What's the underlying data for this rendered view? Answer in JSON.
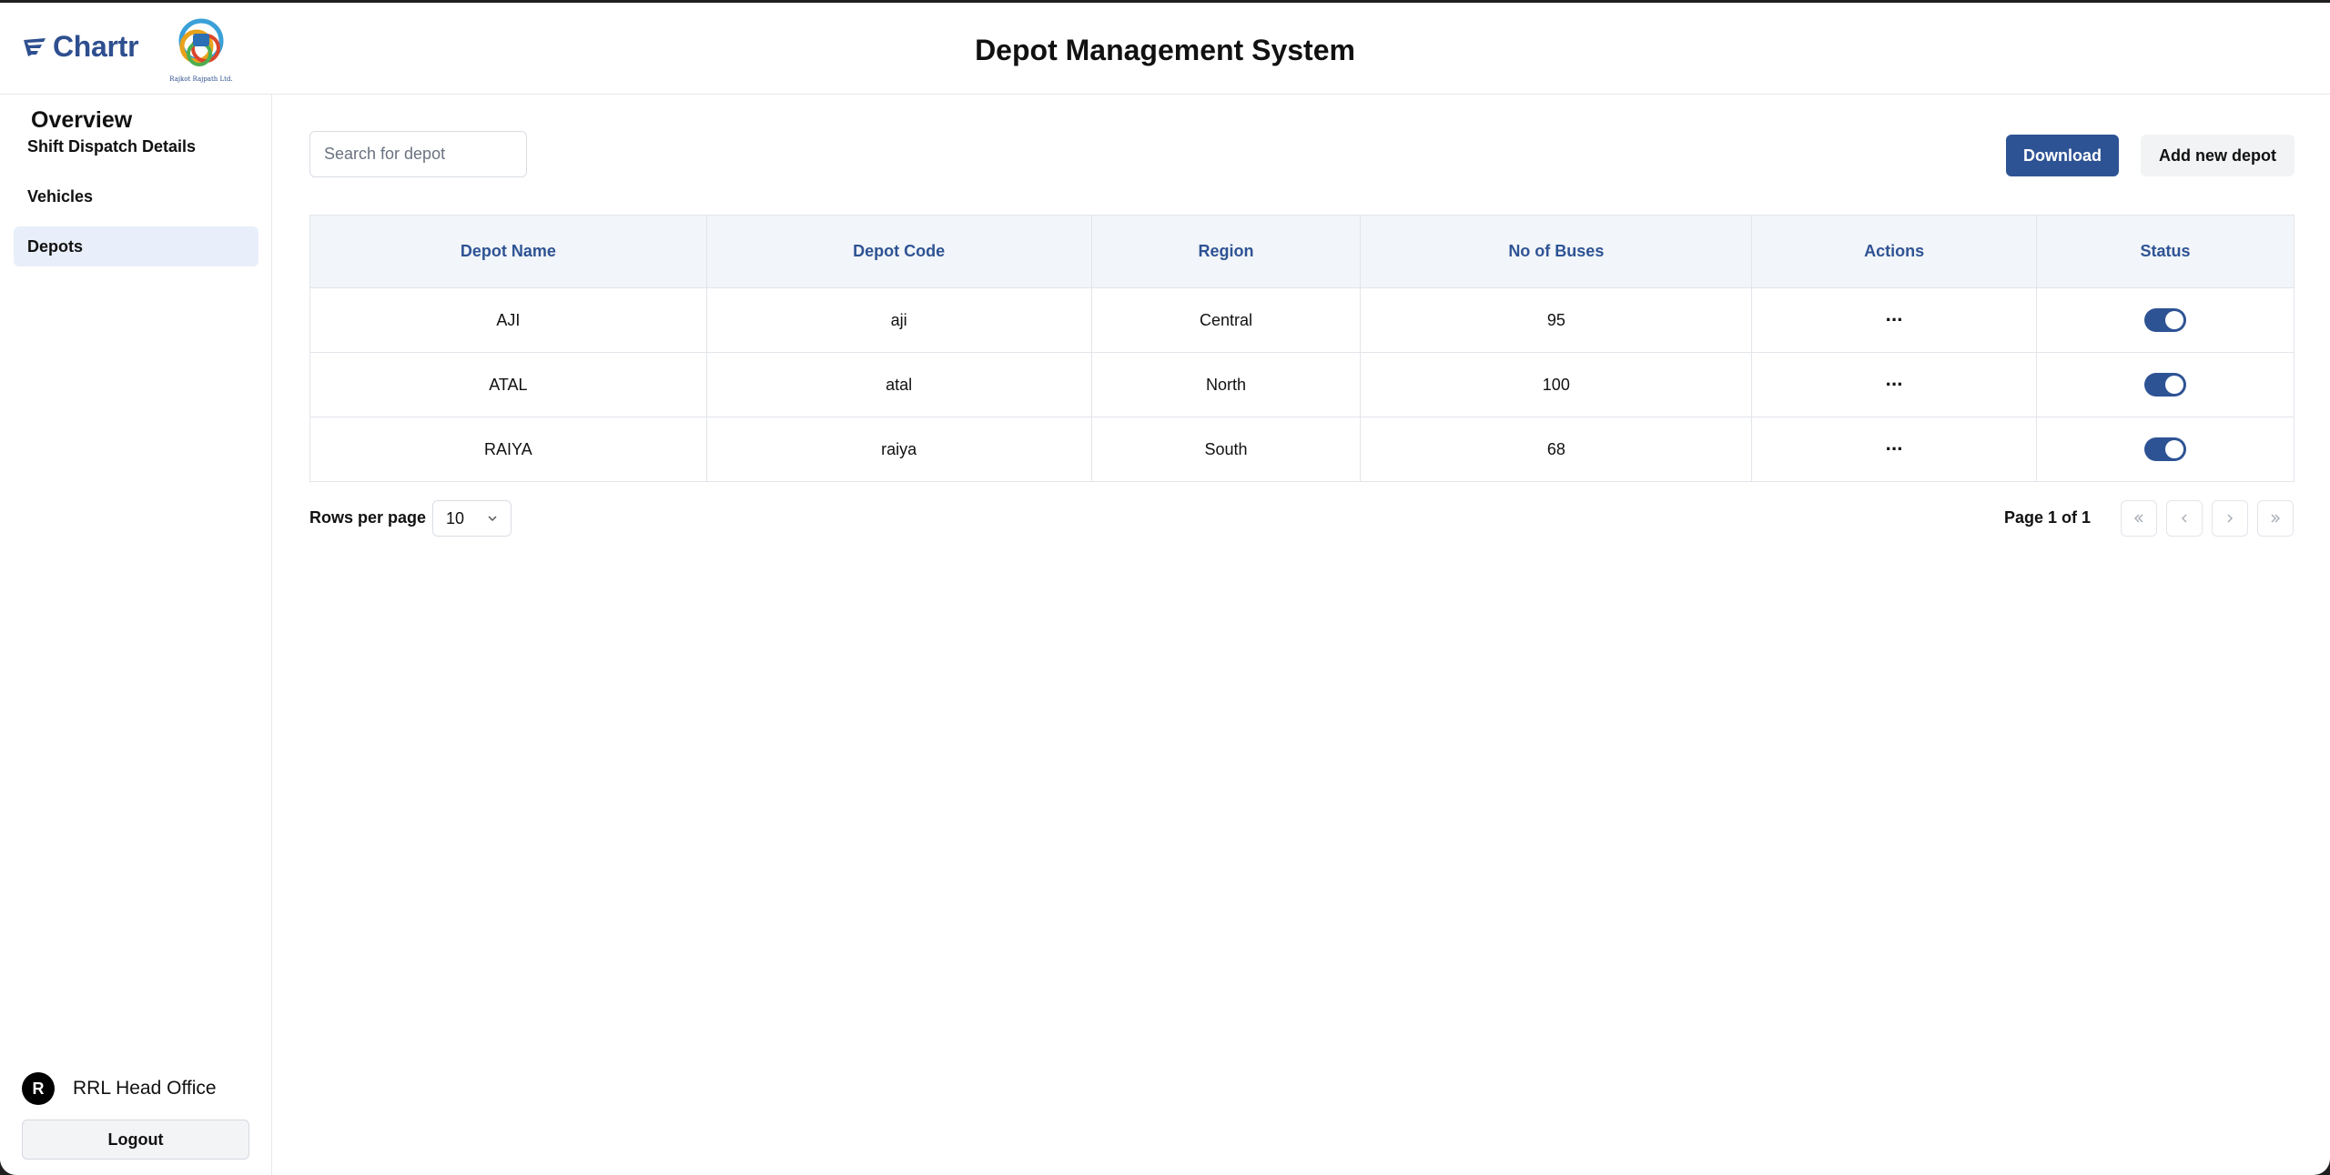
{
  "header": {
    "brand": "Chartr",
    "title": "Depot Management System",
    "partner_logo_text": "Rajkot Rajpath Ltd."
  },
  "sidebar": {
    "title": "Overview",
    "items": [
      {
        "label": "Shift Dispatch Details",
        "active": false
      },
      {
        "label": "Vehicles",
        "active": false
      },
      {
        "label": "Depots",
        "active": true
      }
    ],
    "user": {
      "initial": "R",
      "name": "RRL Head Office"
    },
    "logout_label": "Logout"
  },
  "toolbar": {
    "search_placeholder": "Search for depot",
    "download_label": "Download",
    "add_label": "Add new depot"
  },
  "table": {
    "columns": [
      "Depot Name",
      "Depot Code",
      "Region",
      "No of Buses",
      "Actions",
      "Status"
    ],
    "rows": [
      {
        "name": "AJI",
        "code": "aji",
        "region": "Central",
        "buses": "95",
        "actions": "···",
        "status": true
      },
      {
        "name": "ATAL",
        "code": "atal",
        "region": "North",
        "buses": "100",
        "actions": "···",
        "status": true
      },
      {
        "name": "RAIYA",
        "code": "raiya",
        "region": "South",
        "buses": "68",
        "actions": "···",
        "status": true
      }
    ]
  },
  "pagination": {
    "rows_label": "Rows per page",
    "rows_value": "10",
    "page_info": "Page 1 of 1"
  },
  "colors": {
    "accent": "#2e5394",
    "header_bg": "#f2f5f9",
    "active_nav": "#e8effa"
  }
}
